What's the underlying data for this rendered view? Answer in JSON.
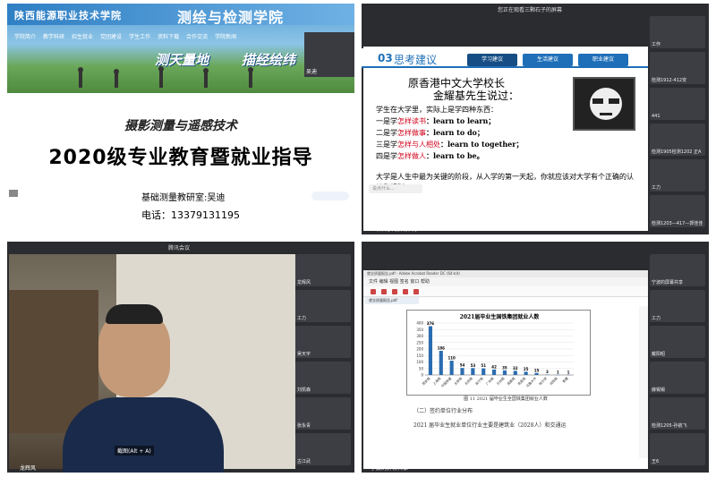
{
  "panel1": {
    "school": "陕西能源职业技术学院",
    "college": "测绘与检测学院",
    "nav": [
      "学院简介",
      "教学科研",
      "招生就业",
      "党团建设",
      "学生工作",
      "资料下载",
      "合作交流",
      "学院新闻"
    ],
    "slogan1": "测天量地",
    "slogan2": "描经绘纬",
    "sidecam_name": "吴迪",
    "subtitle": "摄影测量与遥感技术",
    "title": "2020级专业教育暨就业指导",
    "dept": "基础测量教研室:吴迪",
    "phone": "电话：13379131195"
  },
  "panel2": {
    "window_title": "您正在观看三颗石子的屏幕",
    "slide_num": "03",
    "heading": "思考建议",
    "tabs": [
      "学习建议",
      "生活建议",
      "职业建议"
    ],
    "line1": "原香港中文大学校长",
    "line2": "金耀基先生说过：",
    "intro": "学生在大学里，实际上是学四种东西：",
    "items": [
      {
        "prefix": "一是学",
        "red": "怎样读书",
        "suffix": "：learn to learn；"
      },
      {
        "prefix": "二是学",
        "red": "怎样做事",
        "suffix": "：learn to do；"
      },
      {
        "prefix": "三是学",
        "red": "怎样与人相处",
        "suffix": "：learn to together；"
      },
      {
        "prefix": "四是学",
        "red": "怎样做人",
        "suffix": "：learn to be。"
      }
    ],
    "footer": "大学是人生中最为关键的阶段，从入学的第一天起，你就应该对大学有个正确的认识和规划。",
    "input_placeholder": "说点什么...",
    "share_label": "三颗石子的屏幕共享",
    "cams": [
      "工作",
      "检测1912-412安",
      "441",
      "检测1905检测1202 正A",
      "工力",
      "检测1203—417—郭佳佳"
    ]
  },
  "panel3": {
    "window_title": "腾讯会议",
    "hint": "截图(Alt + A)",
    "user": "龙辉风",
    "cams": [
      "龙辉风",
      "工力",
      "吴天宇",
      "刘凯森",
      "张永青",
      "古江武"
    ]
  },
  "panel4": {
    "app_title": "就业质量报告.pdf - Adobe Acrobat Reader DC (64-bit)",
    "menu": "文件  编辑  视图  签名  窗口  帮助",
    "tab": "就业质量报告.pdf",
    "caption": "图 11   2021 届毕业生全国铁集团就业人数",
    "section": "（二）签约单位行业分布",
    "para": "2021 届毕业生就业单位行业主要是建筑业（2028人）和交通运",
    "share_label": "宁波的屏幕共享",
    "cams": [
      "宁波的屏幕共享",
      "工力",
      "戴阳昭",
      "薛锡锡",
      "检测1205-孙航飞",
      "王6"
    ]
  },
  "chart_data": {
    "type": "bar",
    "title": "2021届毕业生国铁集团就业人数",
    "categories": [
      "西安局",
      "上海局",
      "中国铁建",
      "太原局",
      "北京局",
      "南宁局",
      "广州局",
      "兰州局",
      "成都局",
      "南昌局",
      "乌鲁木齐",
      "哈尔滨",
      "沈阳局",
      "青藏"
    ],
    "values": [
      376,
      186,
      110,
      54,
      53,
      51,
      42,
      35,
      32,
      25,
      15,
      3,
      1,
      1
    ],
    "ylim": [
      0,
      400
    ],
    "y_ticks": [
      "400",
      "350",
      "300",
      "250",
      "200",
      "150",
      "100",
      "50",
      "0"
    ]
  }
}
